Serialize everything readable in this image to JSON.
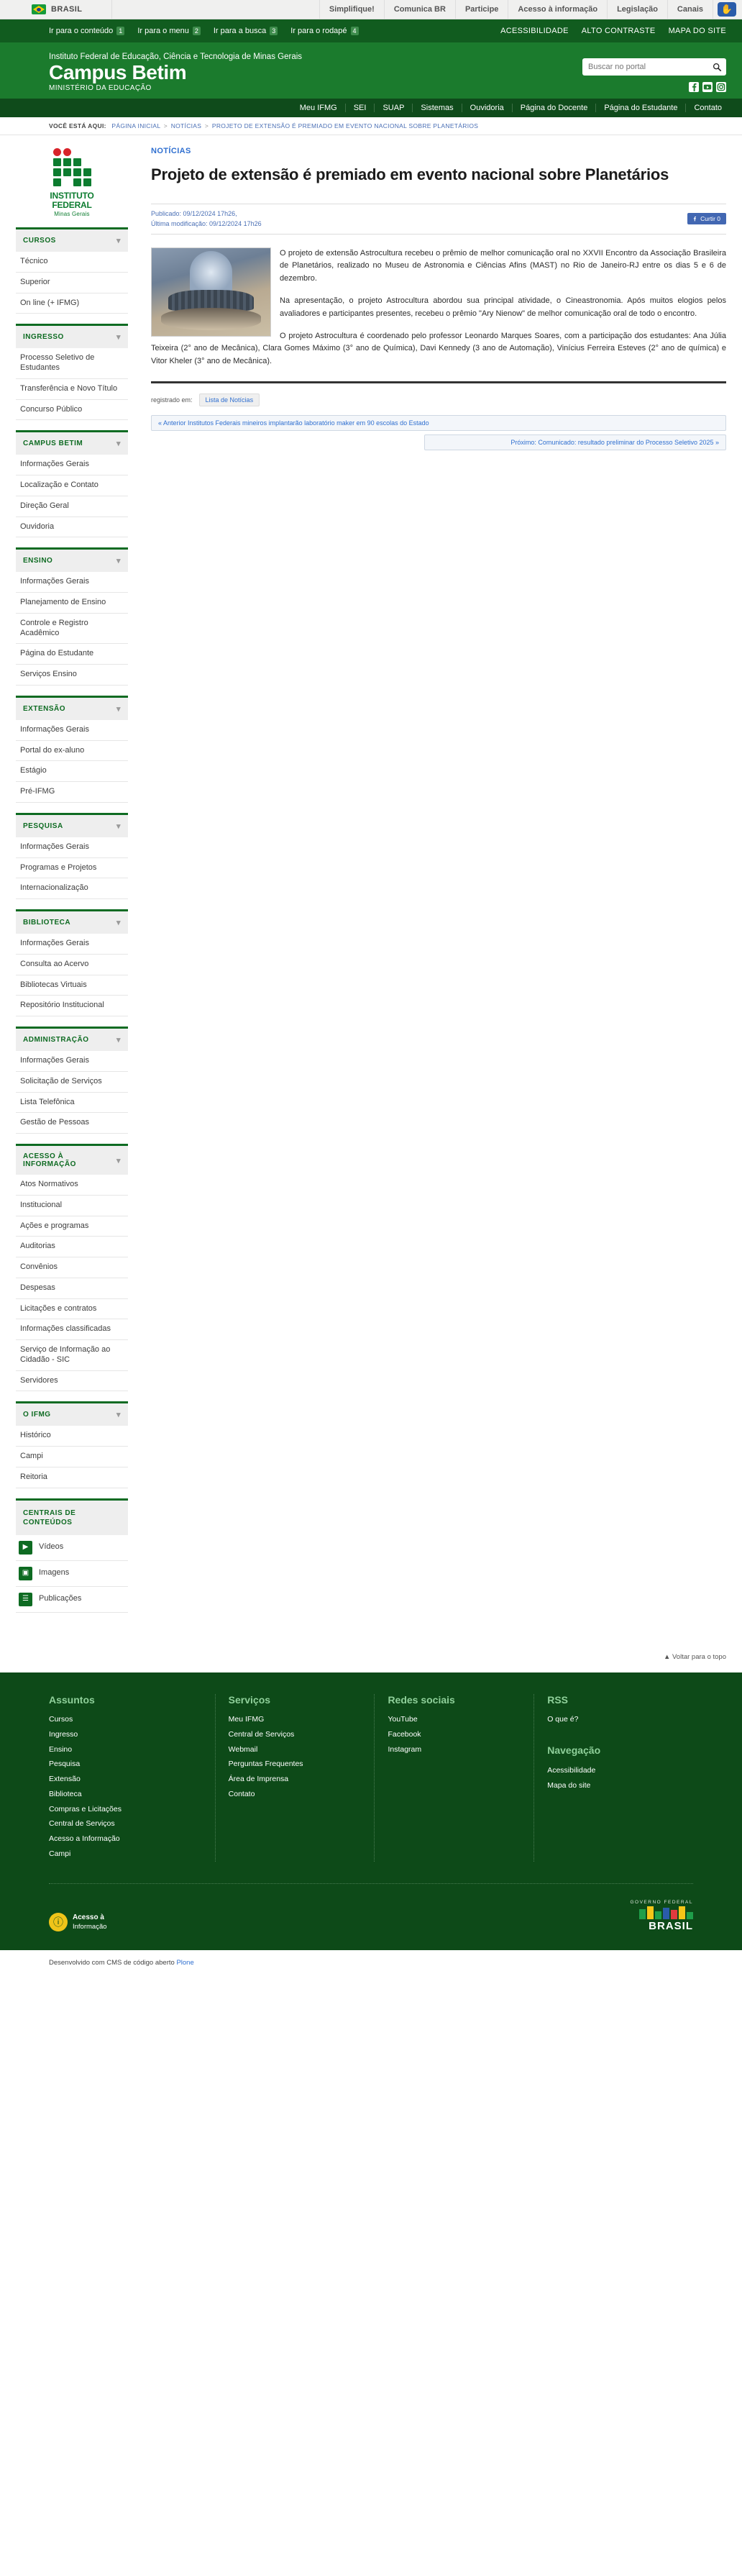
{
  "govbar": {
    "brasil_label": "BRASIL",
    "links": [
      "Simplifique!",
      "Comunica BR",
      "Participe",
      "Acesso à informação",
      "Legislação",
      "Canais"
    ],
    "libras_icon": "libras-hand-icon"
  },
  "skipbar": {
    "items": [
      {
        "label": "Ir para o conteúdo",
        "key": "1"
      },
      {
        "label": "Ir para o menu",
        "key": "2"
      },
      {
        "label": "Ir para a busca",
        "key": "3"
      },
      {
        "label": "Ir para o rodapé",
        "key": "4"
      }
    ],
    "right": [
      "ACESSIBILIDADE",
      "ALTO CONTRASTE",
      "MAPA DO SITE"
    ]
  },
  "header": {
    "institution": "Instituto Federal de Educação, Ciência e Tecnologia de Minas Gerais",
    "campus": "Campus Betim",
    "ministry": "MINISTÉRIO DA EDUCAÇÃO",
    "search_placeholder": "Buscar no portal",
    "search_value": "",
    "socials": [
      "facebook-icon",
      "youtube-icon",
      "instagram-icon"
    ]
  },
  "navbar": {
    "items": [
      "Meu IFMG",
      "SEI",
      "SUAP",
      "Sistemas",
      "Ouvidoria",
      "Página do Docente",
      "Página do Estudante",
      "Contato"
    ]
  },
  "breadcrumb": {
    "prefix": "VOCÊ ESTÁ AQUI:",
    "items": [
      "PÁGINA INICIAL",
      "NOTÍCIAS",
      "PROJETO DE EXTENSÃO É PREMIADO EM EVENTO NACIONAL SOBRE PLANETÁRIOS"
    ]
  },
  "logo": {
    "line1": "INSTITUTO",
    "line2": "FEDERAL",
    "line3": "Minas Gerais"
  },
  "sidebar": {
    "blocks": [
      {
        "title": "CURSOS",
        "items": [
          "Técnico",
          "Superior",
          "On line (+ IFMG)"
        ]
      },
      {
        "title": "INGRESSO",
        "items": [
          "Processo Seletivo de Estudantes",
          "Transferência e Novo Título",
          "Concurso Público"
        ]
      },
      {
        "title": "CAMPUS BETIM",
        "items": [
          "Informações Gerais",
          "Localização e Contato",
          "Direção Geral",
          "Ouvidoria"
        ]
      },
      {
        "title": "ENSINO",
        "items": [
          "Informações Gerais",
          "Planejamento de Ensino",
          "Controle e Registro Acadêmico",
          "Página do Estudante",
          "Serviços Ensino"
        ]
      },
      {
        "title": "EXTENSÃO",
        "items": [
          "Informações Gerais",
          "Portal do ex-aluno",
          "Estágio",
          "Pré-IFMG"
        ]
      },
      {
        "title": "PESQUISA",
        "items": [
          "Informações Gerais",
          "Programas e Projetos",
          "Internacionalização"
        ]
      },
      {
        "title": "BIBLIOTECA",
        "items": [
          "Informações Gerais",
          "Consulta ao Acervo",
          "Bibliotecas Virtuais",
          "Repositório Institucional"
        ]
      },
      {
        "title": "ADMINISTRAÇÃO",
        "items": [
          "Informações Gerais",
          "Solicitação de Serviços",
          "Lista Telefônica",
          "Gestão de Pessoas"
        ]
      },
      {
        "title": "ACESSO À INFORMAÇÃO",
        "items": [
          "Atos Normativos",
          "Institucional",
          "Ações e programas",
          "Auditorias",
          "Convênios",
          "Despesas",
          "Licitações e contratos",
          "Informações classificadas",
          "Serviço de Informação ao Cidadão - SIC",
          "Servidores"
        ]
      },
      {
        "title": "O IFMG",
        "items": [
          "Histórico",
          "Campi",
          "Reitoria"
        ]
      }
    ],
    "centrais": {
      "title": "CENTRAIS DE CONTEÚDOS",
      "items": [
        {
          "label": "Vídeos",
          "icon": "video-camera-icon",
          "glyph": "▶"
        },
        {
          "label": "Imagens",
          "icon": "image-icon",
          "glyph": "▣"
        },
        {
          "label": "Publicações",
          "icon": "book-icon",
          "glyph": "☰"
        }
      ]
    }
  },
  "article": {
    "kicker": "NOTÍCIAS",
    "title": "Projeto de extensão é premiado em evento nacional sobre Planetários",
    "published": "Publicado: 09/12/2024 17h26,",
    "modified": "Última modificação: 09/12/2024 17h26",
    "fb_label": "Curtir 0",
    "photo_alt": "foto-planetario",
    "paragraphs": [
      "O projeto de extensão Astrocultura recebeu o prêmio de melhor comunicação oral no XXVII Encontro da Associação Brasileira de Planetários, realizado no Museu de Astronomia e Ciências Afins (MAST) no Rio de Janeiro-RJ entre os dias 5 e 6 de dezembro.",
      "Na apresentação, o projeto Astrocultura abordou sua principal atividade, o Cineastronomia. Após muitos elogios pelos avaliadores e participantes presentes, recebeu o prêmio \"Ary Nienow\" de melhor comunicação oral de todo o encontro.",
      "O projeto Astrocultura é coordenado pelo professor Leonardo Marques Soares, com a participação dos estudantes: Ana Júlia Teixeira (2° ano de Mecânica), Clara Gomes Máximo (3° ano de Química), Davi Kennedy (3 ano de Automação), Vinícius Ferreira Esteves (2° ano de química) e Vitor Kheler (3° ano de Mecânica)."
    ],
    "registered_label": "registrado em:",
    "tag": "Lista de Notícias",
    "prev_link": "« Anterior Institutos Federais mineiros implantarão laboratório maker em 90 escolas do Estado",
    "next_link": "Próximo: Comunicado: resultado preliminar do Processo Seletivo 2025 »"
  },
  "backtotop": "Voltar para o topo",
  "footer": {
    "columns": [
      {
        "title": "Assuntos",
        "items": [
          "Cursos",
          "Ingresso",
          "Ensino",
          "Pesquisa",
          "Extensão",
          "Biblioteca",
          "Compras e Licitações",
          "Central de Serviços",
          "Acesso a Informação",
          "Campi"
        ]
      },
      {
        "title": "Serviços",
        "items": [
          "Meu IFMG",
          "Central de Serviços",
          "Webmail",
          "Perguntas Frequentes",
          "Área de Imprensa",
          "Contato"
        ]
      },
      {
        "title": "Redes sociais",
        "items": [
          "YouTube",
          "Facebook",
          "Instagram"
        ]
      },
      {
        "title": "RSS",
        "items": [
          "O que é?"
        ],
        "title2": "Navegação",
        "items2": [
          "Acessibilidade",
          "Mapa do site"
        ]
      }
    ],
    "acesso_title": "Acesso à",
    "acesso_sub": "Informação",
    "govbr_top": "GOVERNO FEDERAL",
    "govbr_word": "BRASIL"
  },
  "credit": {
    "text": "Desenvolvido com CMS de código aberto ",
    "link": "Plone"
  },
  "colors": {
    "brand_green": "#1b7b2d",
    "dark_green": "#0f4b1b",
    "link_blue": "#2f6fd0",
    "footer_green": "#0d4a18"
  }
}
